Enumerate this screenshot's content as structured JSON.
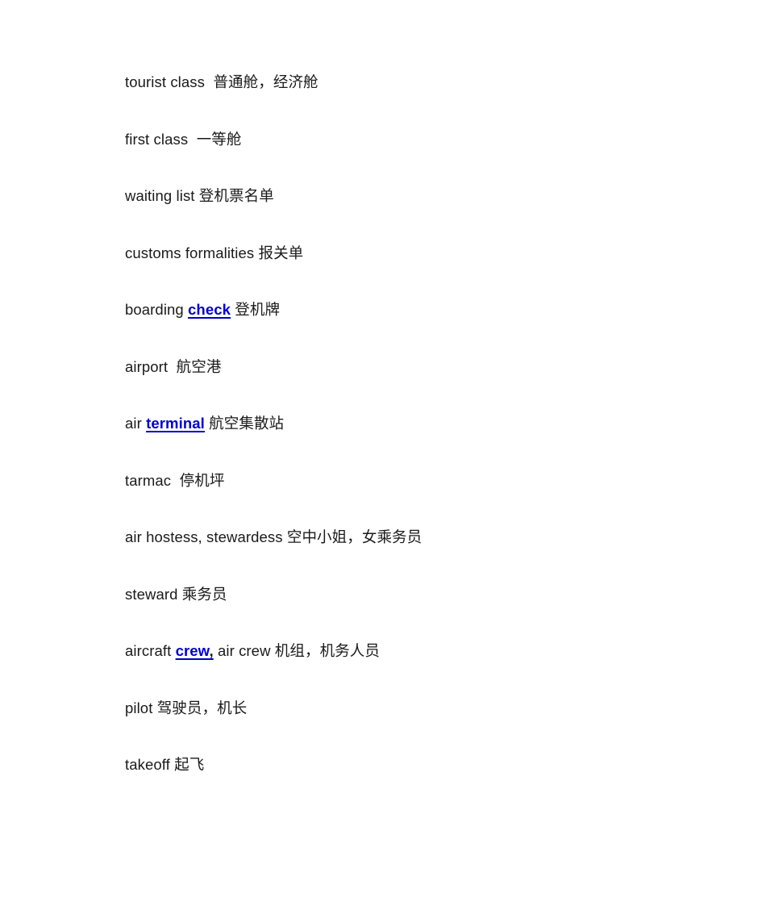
{
  "document": {
    "background_color": "#ffffff",
    "text_color": "#1a1a1a",
    "link_color": "#0000cc",
    "entries": [
      {
        "english": "tourist class",
        "gap": "  ",
        "chinese": "普通舱，经济舱",
        "link": null
      },
      {
        "english": "first class",
        "gap": "  ",
        "chinese": "一等舱",
        "link": null
      },
      {
        "english": "waiting list",
        "gap": " ",
        "chinese": "登机票名单",
        "link": null
      },
      {
        "english": "customs formalities",
        "gap": " ",
        "chinese": "报关单",
        "link": null
      },
      {
        "english": "boarding ",
        "gap": " ",
        "chinese": "登机牌",
        "link": {
          "text": "check",
          "punct": ""
        },
        "english_after": ""
      },
      {
        "english": "airport",
        "gap": "  ",
        "chinese": "航空港",
        "link": null
      },
      {
        "english": "air ",
        "gap": " ",
        "chinese": "航空集散站",
        "link": {
          "text": "terminal",
          "punct": ""
        },
        "english_after": ""
      },
      {
        "english": "tarmac",
        "gap": "  ",
        "chinese": "停机坪",
        "link": null
      },
      {
        "english": "air hostess, stewardess",
        "gap": " ",
        "chinese": "空中小姐，女乘务员",
        "link": null
      },
      {
        "english": "steward",
        "gap": " ",
        "chinese": "乘务员",
        "link": null
      },
      {
        "english": "aircraft ",
        "gap": " ",
        "chinese": "机组，机务人员",
        "link": {
          "text": "crew",
          "punct": ","
        },
        "english_after": " air crew"
      },
      {
        "english": "pilot",
        "gap": " ",
        "chinese": "驾驶员，机长",
        "link": null
      },
      {
        "english": "takeoff",
        "gap": " ",
        "chinese": "起飞",
        "link": null
      }
    ]
  }
}
